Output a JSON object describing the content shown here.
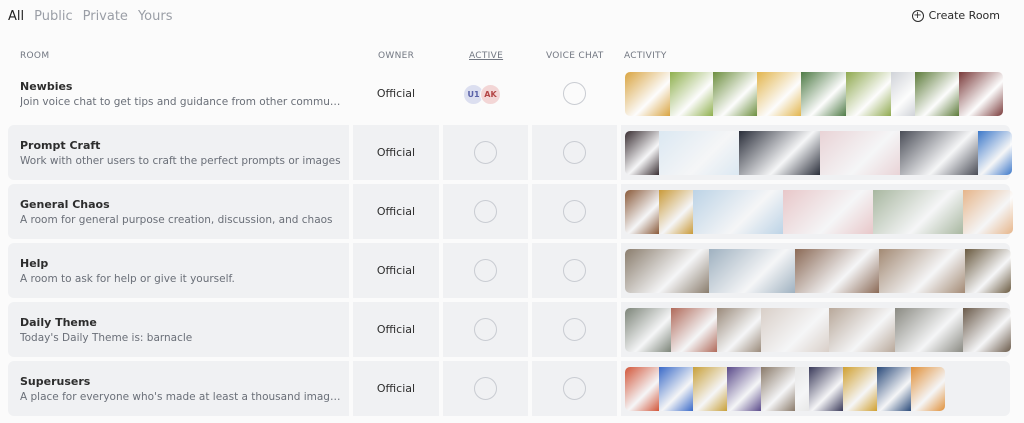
{
  "tabs": [
    {
      "label": "All",
      "active": true
    },
    {
      "label": "Public",
      "active": false
    },
    {
      "label": "Private",
      "active": false
    },
    {
      "label": "Yours",
      "active": false
    }
  ],
  "create_room_label": "Create Room",
  "columns": {
    "room": "ROOM",
    "owner": "OWNER",
    "active": "ACTIVE",
    "voice": "VOICE CHAT",
    "activity": "ACTIVITY"
  },
  "rooms": [
    {
      "name": "Newbies",
      "description": "Join voice chat to get tips and guidance from other communi...",
      "owner": "Official",
      "active_users": [
        {
          "initials": "U1",
          "bg": "#dcdff0",
          "fg": "#5a62a8"
        },
        {
          "initials": "AK",
          "bg": "#f3d6d6",
          "fg": "#b44646"
        }
      ],
      "thumbnails": [
        "#d9a441",
        "#8fb04e",
        "#6d8f3f",
        "#e2b54d",
        "#4f7b46",
        "#8fa94f",
        "#d0d3d8",
        "#5d7b3a",
        "#7a3a3a"
      ]
    },
    {
      "name": "Prompt Craft",
      "description": "Work with other users to craft the perfect prompts or images",
      "owner": "Official",
      "active_users": [],
      "thumbnails": [
        "#3a2f33",
        "#dbe8f2",
        "#2a2e3a",
        "#e9d3d6",
        "#4a4d57",
        "#3c78c9"
      ]
    },
    {
      "name": "General Chaos",
      "description": "A room for general purpose creation, discussion, and chaos",
      "owner": "Official",
      "active_users": [],
      "thumbnails": [
        "#8a5a3a",
        "#c99a3a",
        "#bcd3e6",
        "#e8c7c9",
        "#a8b7a0",
        "#e6b58a"
      ]
    },
    {
      "name": "Help",
      "description": "A room to ask for help or give it yourself.",
      "owner": "Official",
      "active_users": [],
      "thumbnails": [
        "#8a7d6d",
        "#9fb1c0",
        "#8b6a56",
        "#a38a74",
        "#6a5a40"
      ]
    },
    {
      "name": "Daily Theme",
      "description": "Today's Daily Theme is: barnacle",
      "owner": "Official",
      "active_users": [],
      "thumbnails": [
        "#7c8478",
        "#b06a5a",
        "#9a8a7a",
        "#d9cfc8",
        "#b8a89a",
        "#8a8a82",
        "#6a5a4a"
      ]
    },
    {
      "name": "Superusers",
      "description": "A place for everyone who's made at least a thousand images ...",
      "owner": "Official",
      "active_users": [],
      "thumbnails": [
        "#d2563a",
        "#3a6ac8",
        "#c8a03a",
        "#5a4a8a",
        "#8a7a6a",
        "#e8e8e8",
        "#3a3a5a",
        "#d0a030",
        "#2a4a7a",
        "#e0903a"
      ]
    }
  ]
}
